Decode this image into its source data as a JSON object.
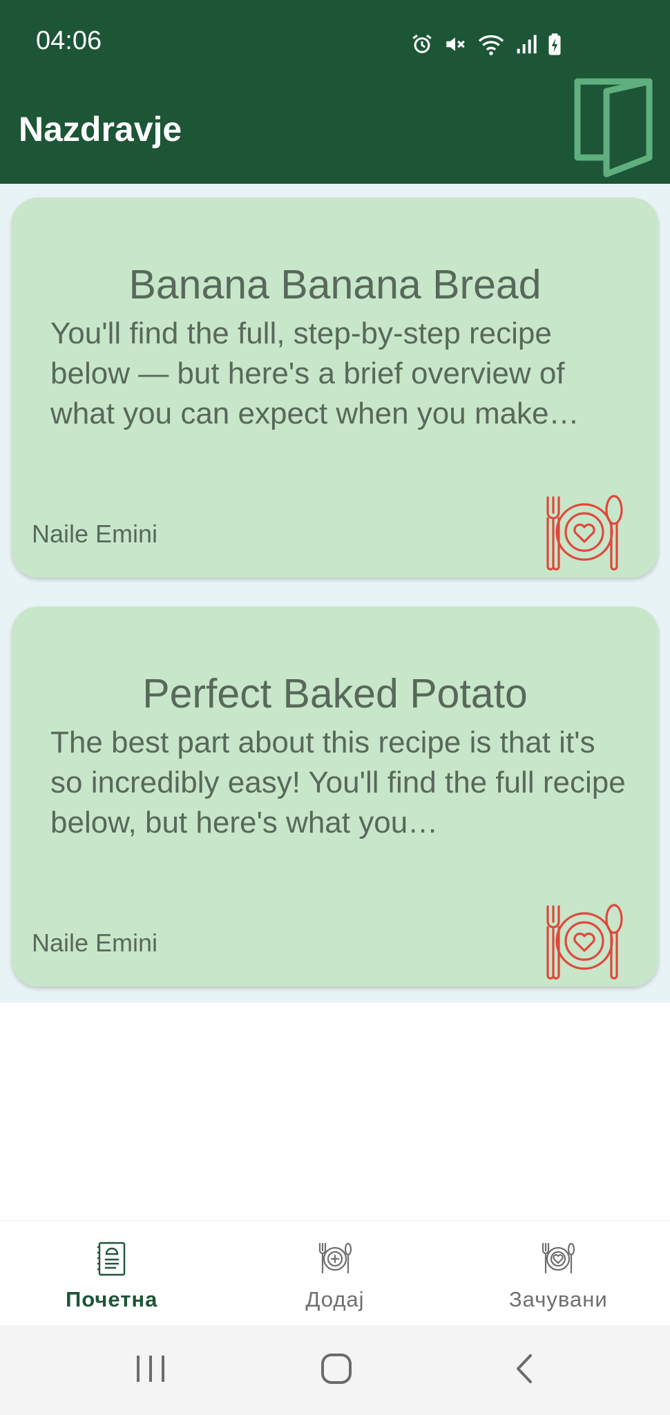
{
  "status_bar": {
    "time": "04:06",
    "icons": [
      "alarm-icon",
      "mute-icon",
      "wifi-icon",
      "signal-icon",
      "battery-charging-icon"
    ]
  },
  "header": {
    "title": "Nazdravje",
    "action_icon": "logout-door-icon"
  },
  "recipes": [
    {
      "title": "Banana Banana Bread",
      "description": "You'll find the full, step-by-step recipe below — but here's a brief overview of what you can expect when you make…",
      "author": "Naile Emini",
      "icon": "plate-heart-cutlery-icon"
    },
    {
      "title": "Perfect Baked Potato",
      "description": "The best part about this recipe is that it's so incredibly easy! You'll find the full recipe below, but here's what you…",
      "author": "Naile Emini",
      "icon": "plate-heart-cutlery-icon"
    }
  ],
  "bottom_nav": {
    "items": [
      {
        "label": "Почетна",
        "icon": "recipe-book-icon",
        "active": true
      },
      {
        "label": "Додај",
        "icon": "plate-plus-icon",
        "active": false
      },
      {
        "label": "Зачувани",
        "icon": "plate-heart-icon",
        "active": false
      }
    ]
  },
  "system_nav": {
    "buttons": [
      "recent-apps-icon",
      "home-icon",
      "back-icon"
    ]
  },
  "colors": {
    "primary": "#1d5537",
    "card": "#c8e6c9",
    "background": "#e7f3f4",
    "card_text": "#57695a",
    "accent_icon": "#e0483c",
    "logout_icon": "#5fb07e"
  }
}
